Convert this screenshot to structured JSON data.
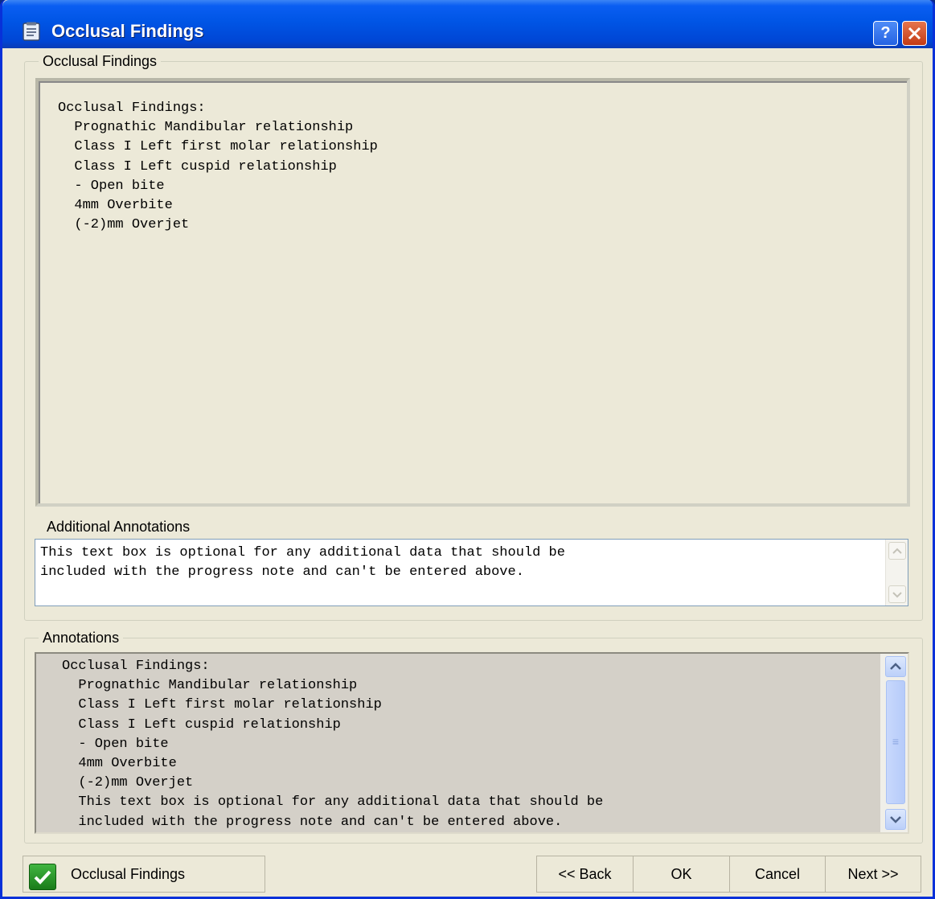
{
  "window": {
    "title": "Occlusal Findings"
  },
  "findings_group": {
    "legend": "Occlusal Findings",
    "lines": [
      "Occlusal Findings:",
      "  Prognathic Mandibular relationship",
      "  Class I Left first molar relationship",
      "  Class I Left cuspid relationship",
      "  - Open bite",
      "  4mm Overbite",
      "  (-2)mm Overjet"
    ]
  },
  "additional_annotations": {
    "label": "Additional Annotations",
    "value": "This text box is optional for any additional data that should be\nincluded with the progress note and can't be entered above."
  },
  "annotations_group": {
    "legend": "Annotations",
    "lines": [
      "Occlusal Findings:",
      "  Prognathic Mandibular relationship",
      "  Class I Left first molar relationship",
      "  Class I Left cuspid relationship",
      "  - Open bite",
      "  4mm Overbite",
      "  (-2)mm Overjet",
      "  This text box is optional for any additional data that should be",
      "  included with the progress note and can't be entered above."
    ]
  },
  "status": {
    "label": "Occlusal Findings"
  },
  "buttons": {
    "back": "<< Back",
    "ok": "OK",
    "cancel": "Cancel",
    "next": "Next >>"
  },
  "icons": {
    "app": "clipboard-icon",
    "help": "help-icon",
    "close": "close-icon",
    "scroll_up": "chevron-up-icon",
    "scroll_down": "chevron-down-icon",
    "status": "checkmark-icon"
  },
  "colors": {
    "titlebar": "#0055e5",
    "close_button": "#c33b15",
    "dialog_bg": "#ece9d8",
    "check_green": "#2a9a2a"
  }
}
